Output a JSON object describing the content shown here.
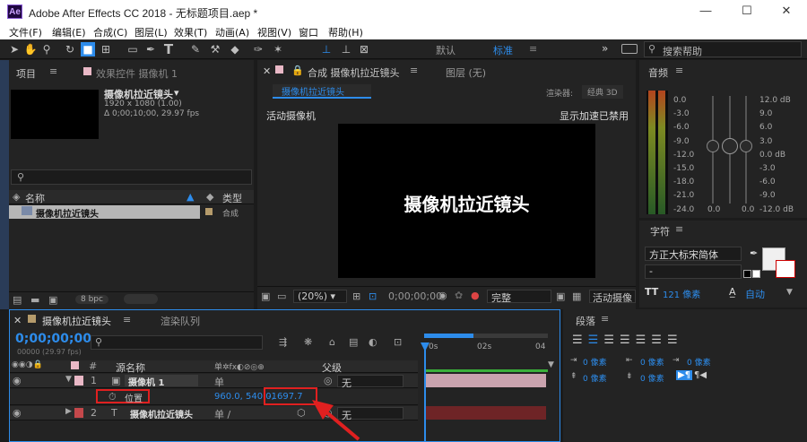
{
  "window": {
    "title": "Adobe After Effects CC 2018 - 无标题项目.aep *",
    "logo": "Ae",
    "min": "—",
    "max": "☐",
    "close": "✕"
  },
  "menu": [
    "文件(F)",
    "编辑(E)",
    "合成(C)",
    "图层(L)",
    "效果(T)",
    "动画(A)",
    "视图(V)",
    "窗口",
    "帮助(H)"
  ],
  "toolbar": {
    "workspace_default": "默认",
    "workspace_standard": "标准",
    "search_placeholder": "搜索帮助"
  },
  "project": {
    "tab": "项目",
    "effect_tab": "效果控件 摄像机 1",
    "item_name": "摄像机拉近镜头",
    "item_info1": "1920 x 1080 (1.00)",
    "item_info2": "Δ 0;00;10;00, 29.97 fps",
    "col_name": "名称",
    "col_type": "类型",
    "row_name": "摄像机拉近镜头",
    "row_type": "合成",
    "bpc": "8 bpc"
  },
  "composition": {
    "tab": "合成 摄像机拉近镜头",
    "layer_tab": "图层 (无)",
    "subtab": "摄像机拉近镜头",
    "renderer_label": "渲染器:",
    "renderer": "经典 3D",
    "active_camera": "活动摄像机",
    "accel_disabled": "显示加速已禁用",
    "canvas_text": "摄像机拉近镜头",
    "zoom": "(20%)",
    "timecode": "0;00;00;00",
    "quality": "完整",
    "view": "活动摄像"
  },
  "audio": {
    "tab": "音频",
    "left_scale": [
      "0.0",
      "-3.0",
      "-6.0",
      "-9.0",
      "-12.0",
      "-15.0",
      "-18.0",
      "-21.0",
      "-24.0"
    ],
    "right_scale": [
      "12.0 dB",
      "6.0",
      "0.0 dB",
      "-6.0",
      "-12.0 dB"
    ],
    "right_ticks": [
      "12.0 dB",
      "9.0",
      "6.0",
      "3.0",
      "0.0 dB",
      "-3.0",
      "-6.0",
      "-9.0",
      "-12.0 dB"
    ],
    "bottom": [
      "0.0",
      "0.0"
    ]
  },
  "character": {
    "tab": "字符",
    "font": "方正大标宋简体",
    "style": "-",
    "size": "121 像素",
    "leading": "自动",
    "size_unit": "像素"
  },
  "paragraph": {
    "tab": "段落",
    "indent_values": [
      "0 像素",
      "0 像素",
      "0 像素",
      "0 像素",
      "0 像素"
    ]
  },
  "timeline": {
    "tab": "摄像机拉近镜头",
    "render_tab": "渲染队列",
    "timecode": "0;00;00;00",
    "fps": "00000 (29.97 fps)",
    "col_source": "源名称",
    "col_parent": "父级",
    "col_num": "#",
    "ruler": [
      "0s",
      "02s",
      "04"
    ],
    "layers": [
      {
        "num": "1",
        "name": "摄像机 1",
        "parent": "无",
        "color": "#e9b8c6"
      },
      {
        "num": "2",
        "name": "摄像机拉近镜头",
        "parent": "无",
        "color": "#c4484b"
      }
    ],
    "prop_name": "位置",
    "prop_value_xy": "960.0, 540.0,",
    "prop_value_z": "-1697.7"
  },
  "colors": {
    "accent": "#2d8ceb",
    "highlight_box": "#e02020",
    "layer1_bar": "#c9a3ae",
    "layer2_bar": "#6e2426"
  }
}
